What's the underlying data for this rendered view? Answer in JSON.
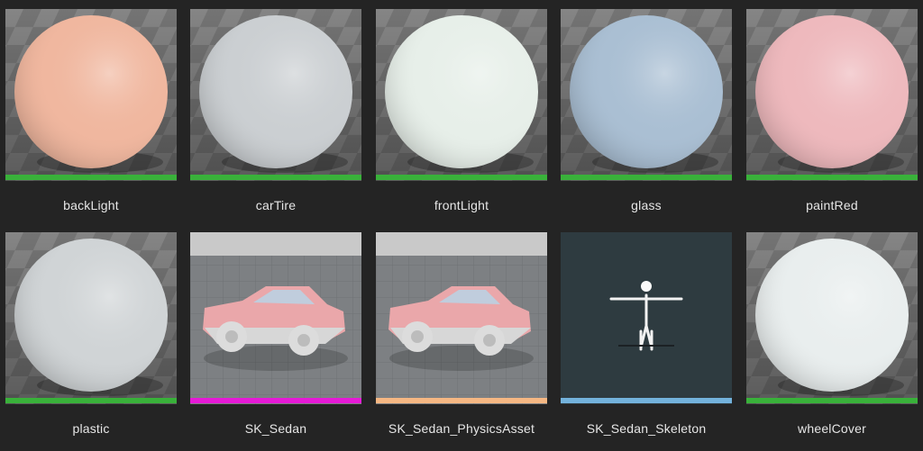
{
  "assets": [
    {
      "name": "backLight",
      "type": "material",
      "color": "#f0b79f",
      "bar": "#39b13a"
    },
    {
      "name": "carTire",
      "type": "material",
      "color": "#cbcfd2",
      "bar": "#39b13a"
    },
    {
      "name": "frontLight",
      "type": "material",
      "color": "#e7efe9",
      "bar": "#39b13a"
    },
    {
      "name": "glass",
      "type": "material",
      "color": "#aabfd3",
      "bar": "#39b13a"
    },
    {
      "name": "paintRed",
      "type": "material",
      "color": "#eeb9bd",
      "bar": "#39b13a"
    },
    {
      "name": "plastic",
      "type": "material",
      "color": "#d0d4d6",
      "bar": "#39b13a"
    },
    {
      "name": "SK_Sedan",
      "type": "mesh",
      "color": "#eaa7aa",
      "bar": "#e619d6"
    },
    {
      "name": "SK_Sedan_PhysicsAsset",
      "type": "mesh",
      "color": "#eaa7aa",
      "bar": "#f5b783"
    },
    {
      "name": "SK_Sedan_Skeleton",
      "type": "skeleton",
      "color": "#2e3b40",
      "bar": "#73b2dc"
    },
    {
      "name": "wheelCover",
      "type": "material",
      "color": "#e9eeee",
      "bar": "#39b13a"
    }
  ]
}
